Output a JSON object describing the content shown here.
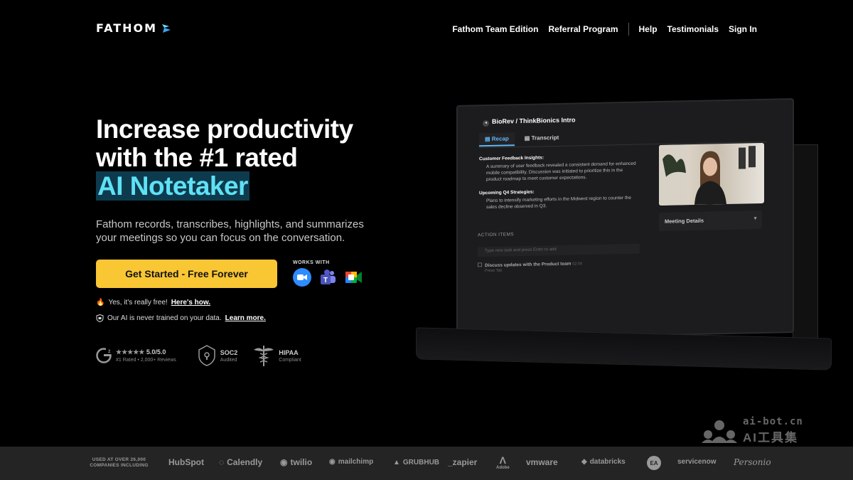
{
  "nav": {
    "logo": "FATHOM",
    "links": [
      "Fathom Team Edition",
      "Referral Program"
    ],
    "links2": [
      "Help",
      "Testimonials",
      "Sign In"
    ]
  },
  "hero": {
    "title_line1": "Increase productivity",
    "title_line2": "with the #1 rated",
    "title_highlight": "AI Notetaker",
    "subtitle": "Fathom records, transcribes, highlights, and summarizes your meetings so you can focus on the conversation.",
    "cta": "Get Started - Free Forever",
    "works_with": "WORKS WITH",
    "works_with_icons": [
      "zoom-icon",
      "teams-icon",
      "google-meet-icon"
    ],
    "note1_text": "Yes, it's really free!",
    "note1_link": "Here's how.",
    "note2_text": "Our AI is never trained on your data.",
    "note2_link": "Learn more.",
    "rating_value": "5.0/5.0",
    "rating_stars": 5,
    "rating_sub": "#1 Rated • 2,000+ Reviews",
    "soc2_t1": "SOC2",
    "soc2_t2": "Audited",
    "hipaa_t1": "HIPAA",
    "hipaa_t2": "Compliant"
  },
  "app": {
    "title": "BioRev / ThinkBionics Intro",
    "tab_active": "Recap",
    "tab_other": "Transcript",
    "sec1_head": "Customer Feedback Insights:",
    "sec1_body": "A summary of user feedback revealed a consistent demand for enhanced mobile compatibility. Discussion was initiated to prioritize this in the product roadmap to meet customer expectations.",
    "sec2_head": "Upcoming Q4 Strategies:",
    "sec2_body": "Plans to intensify marketing efforts in the Midwest region to counter the sales decline observed in Q3.",
    "meeting_details": "Meeting Details",
    "action_items": "ACTION ITEMS",
    "input_placeholder": "Type new task and press Enter to add",
    "task": "Discuss updates with the Product team",
    "task_time": "02:04",
    "task_sub": "Press Tab"
  },
  "footer": {
    "label": "USED AT OVER 26,000 COMPANIES INCLUDING",
    "brands": [
      "HubSpot",
      "Calendly",
      "twilio",
      "mailchimp",
      "GRUBHUB",
      "_zapier",
      "Adobe",
      "vmware",
      "databricks",
      "EA",
      "servicenow",
      "Personio"
    ]
  },
  "watermark": {
    "line1": "ai-bot.cn",
    "line2": "AI工具集"
  },
  "colors": {
    "cta": "#f9c634",
    "highlight_text": "#5fe1f6",
    "highlight_bg": "#0d3b4d",
    "accent_blue": "#5fb6f6"
  }
}
